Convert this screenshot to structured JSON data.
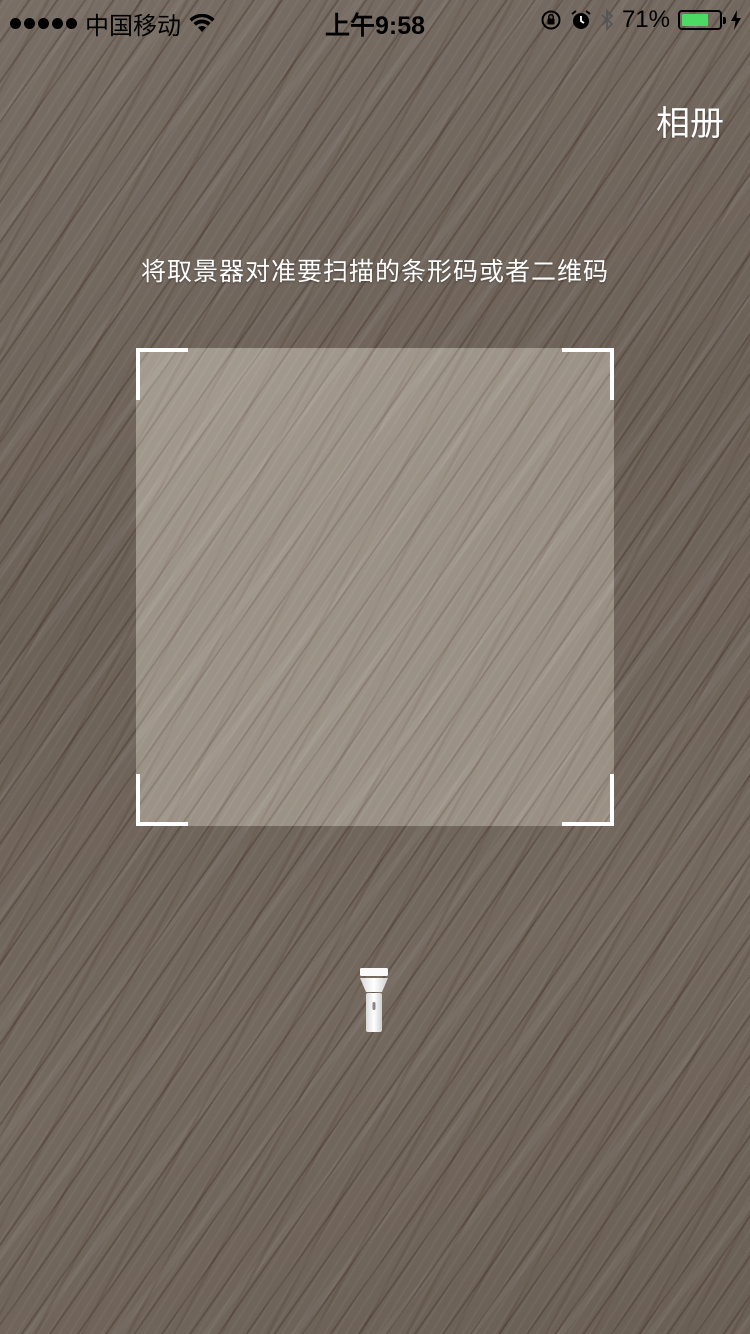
{
  "status_bar": {
    "carrier": "中国移动",
    "time": "上午9:58",
    "battery_percent": "71%",
    "battery_level": 0.71,
    "battery_color": "#4cd964",
    "icons": [
      "signal-icon",
      "wifi-icon",
      "orientation-lock-icon",
      "alarm-icon",
      "bluetooth-icon",
      "battery-icon",
      "charging-icon"
    ]
  },
  "header": {
    "album_label": "相册"
  },
  "scanner": {
    "hint": "将取景器对准要扫描的条形码或者二维码",
    "frame_corner_color": "#ffffff",
    "flashlight_icon": "flashlight-icon"
  }
}
